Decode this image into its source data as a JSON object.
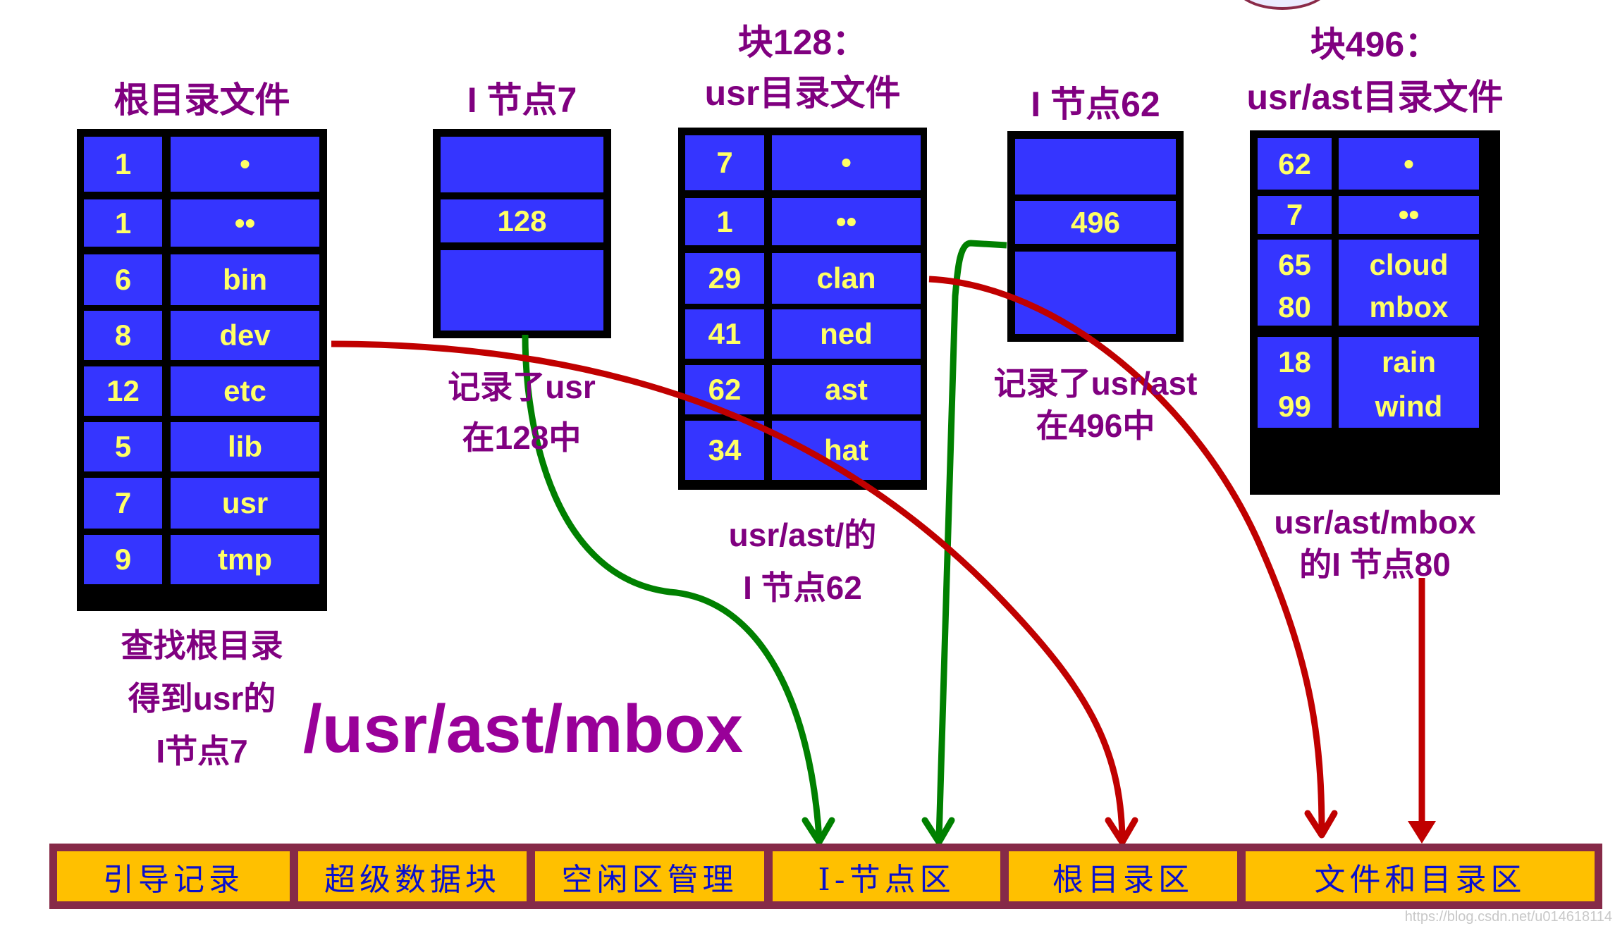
{
  "titles": {
    "root_dir": "根目录文件",
    "inode7": "I 节点7",
    "block128_line1": "块128：",
    "block128_line2": "usr目录文件",
    "inode62": "I 节点62",
    "block496_line1": "块496：",
    "block496_line2": "usr/ast目录文件"
  },
  "root_table": [
    {
      "inode": "1",
      "name": "•"
    },
    {
      "inode": "1",
      "name": "••"
    },
    {
      "inode": "6",
      "name": "bin"
    },
    {
      "inode": "8",
      "name": "dev"
    },
    {
      "inode": "12",
      "name": "etc"
    },
    {
      "inode": "5",
      "name": "lib"
    },
    {
      "inode": "7",
      "name": "usr"
    },
    {
      "inode": "9",
      "name": "tmp"
    }
  ],
  "inode7": {
    "rows": [
      "",
      "128",
      ""
    ]
  },
  "usr_table": [
    {
      "inode": "7",
      "name": "•"
    },
    {
      "inode": "1",
      "name": "••"
    },
    {
      "inode": "29",
      "name": "clan"
    },
    {
      "inode": "41",
      "name": "ned"
    },
    {
      "inode": "62",
      "name": "ast"
    },
    {
      "inode": "34",
      "name": "hat"
    }
  ],
  "inode62": {
    "rows": [
      "",
      "496",
      ""
    ]
  },
  "ast_table": [
    {
      "inode": "62",
      "name": "•"
    },
    {
      "inode": "7",
      "name": "••"
    },
    {
      "inode": "65",
      "name": "cloud"
    },
    {
      "inode": "80",
      "name": "mbox"
    },
    {
      "inode": "18",
      "name": "rain"
    },
    {
      "inode": "99",
      "name": "wind"
    }
  ],
  "captions": {
    "root_lookup": [
      "查找根目录",
      "得到usr的",
      "I节点7"
    ],
    "inode7_note": [
      "记录了usr",
      "在128中"
    ],
    "usr_note": [
      "usr/ast/的",
      "I 节点62"
    ],
    "inode62_note": [
      "记录了usr/ast",
      "在496中"
    ],
    "ast_note": [
      "usr/ast/mbox",
      "的I 节点80"
    ]
  },
  "path": "/usr/ast/mbox",
  "disk_layout": [
    "引导记录",
    "超级数据块",
    "空闲区管理",
    "I-节点区",
    "根目录区",
    "文件和目录区"
  ],
  "watermark": "https://blog.csdn.net/u014618114",
  "colors": {
    "cell_bg": "#3535ff",
    "cell_text": "#ffff66",
    "title_text": "#800080",
    "arrow_green": "#008000",
    "arrow_red": "#c00000",
    "bar_fill": "#ffc000",
    "bar_border": "#862a48",
    "bar_text": "#0a10cc"
  }
}
